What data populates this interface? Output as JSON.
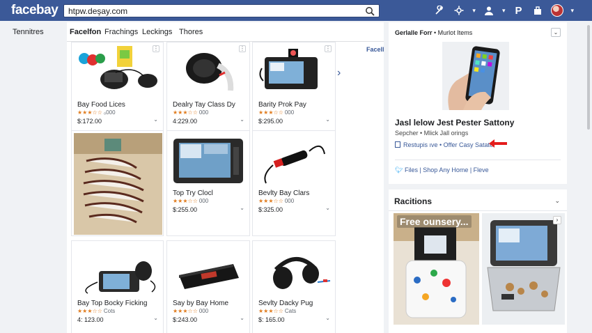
{
  "topbar": {
    "logo": "facebay",
    "url": "htpw.deşay.com",
    "icons": [
      "search-icon",
      "wrench-icon",
      "settings-icon",
      "user-icon",
      "pinterest-icon",
      "shop-icon",
      "avatar"
    ],
    "brand_color": "#3b5998",
    "p_label": "P"
  },
  "leftnav": {
    "label": "Tennitres"
  },
  "tabs": [
    {
      "label": "Facelfon",
      "active": true
    },
    {
      "label": "Frachings",
      "active": false
    },
    {
      "label": "Leckings",
      "active": false
    },
    {
      "label": "Thores",
      "active": false
    }
  ],
  "main": {
    "corner_link": "Facell"
  },
  "products": [
    {
      "title": "Bay Food Lices",
      "stars": "★★★☆☆",
      "rating": "₀000",
      "price": "$:172.00",
      "image": "bluetooth-speaker-kit"
    },
    {
      "title": "Dealry Tay Class Dy",
      "stars": "★★★☆☆",
      "rating": "000",
      "price": "4:229.00",
      "image": "headphones"
    },
    {
      "title": "Barity Prok Pay",
      "stars": "★★★☆☆",
      "rating": "000",
      "price": "$:295.00",
      "image": "gps-device"
    },
    {
      "title": "",
      "stars": "",
      "rating": "",
      "price": "",
      "image": "cable-bundle"
    },
    {
      "title": "Top Try Clocl",
      "stars": "★★★☆☆",
      "rating": "000",
      "price": "$:255.00",
      "image": "tablet-device"
    },
    {
      "title": "Bevlty Bay Clars",
      "stars": "★★★☆☆",
      "rating": "000",
      "price": "$:325.00",
      "image": "car-charger"
    },
    {
      "title": "Bay Top Bocky Ficking",
      "stars": "★★★☆☆",
      "rating": "Cots",
      "price": "4: 123.00",
      "image": "dashcam"
    },
    {
      "title": "Say by Bay Home",
      "stars": "★★★☆☆",
      "rating": "000",
      "price": "$:243.00",
      "image": "black-case"
    },
    {
      "title": "Sevlty Dacky Pug",
      "stars": "★★★☆☆",
      "rating": "Cats",
      "price": "$: 165.00",
      "image": "headset"
    }
  ],
  "sidebar_ad": {
    "header_bold": "Gerlalle Forr",
    "header_rest": " • Murlot Items",
    "title": "Jasl lelow Jest Pester Sattony",
    "subtitle": "Sepcher • Mlick Jall orings",
    "link": "Restupis ıve • Offer Casy Satate",
    "links_row": "Files  |  Shop Any Home  |  Fleve",
    "accent": "#385898",
    "arrow_color": "#e41c1c"
  },
  "sidebar_reactions": {
    "title": "Racitions",
    "overlay": "Free ounsery..."
  }
}
